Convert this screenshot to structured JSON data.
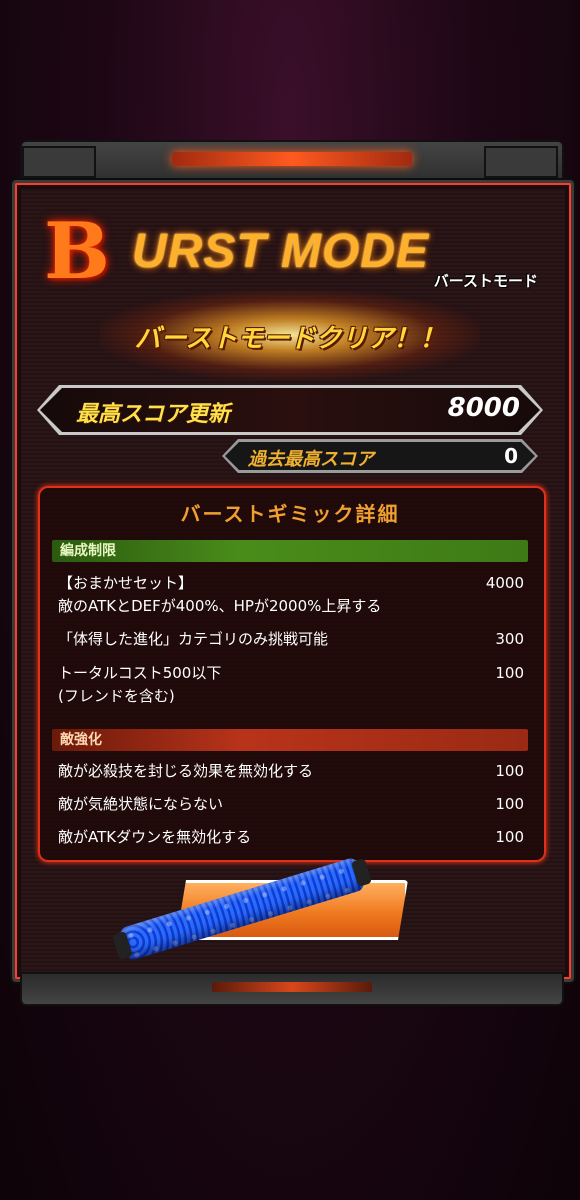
{
  "logo": {
    "flame_letter": "B",
    "word": "URST MODE",
    "subtitle": "バーストモード"
  },
  "clear_text": "バーストモードクリア！！",
  "score": {
    "label": "最高スコア更新",
    "value": "8000"
  },
  "past": {
    "label": "過去最高スコア",
    "value": "0"
  },
  "details": {
    "title": "バーストギミック詳細",
    "sections": [
      {
        "header": "編成制限",
        "rows": [
          {
            "text": "【おまかせセット】",
            "text2": "敵のATKとDEFが400%、HPが2000%上昇する",
            "value": "4000"
          },
          {
            "text": "「体得した進化」カテゴリのみ挑戦可能",
            "value": "300"
          },
          {
            "text": "トータルコスト500以下",
            "text2": "(フレンドを含む)",
            "value": "100"
          }
        ]
      },
      {
        "header": "敵強化",
        "rows": [
          {
            "text": "敵が必殺技を封じる効果を無効化する",
            "value": "100"
          },
          {
            "text": "敵が気絶状態にならない",
            "value": "100"
          },
          {
            "text": "敵がATKダウンを無効化する",
            "value": "100"
          }
        ]
      }
    ]
  },
  "colors": {
    "accent": "#ff3c2a",
    "gold": "#ffd83a",
    "green_header": "#4a8c1a",
    "red_header": "#b8331a"
  }
}
